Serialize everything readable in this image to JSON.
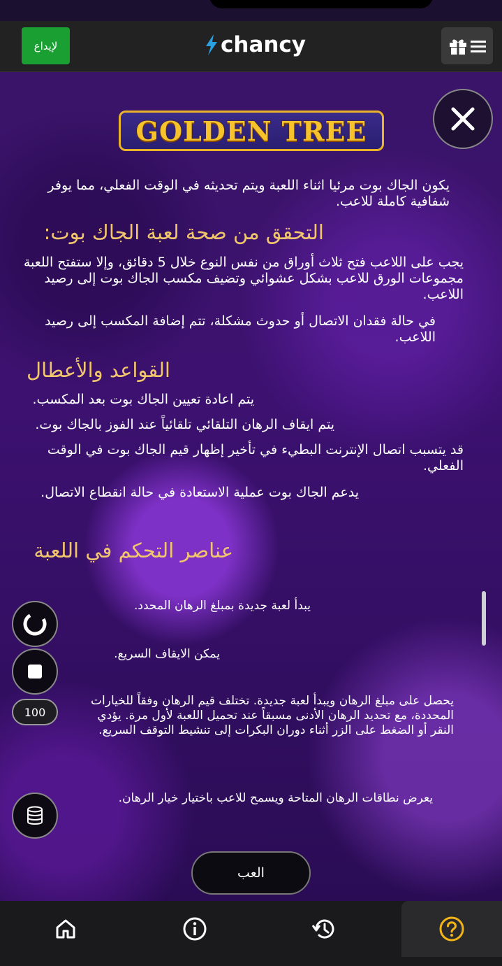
{
  "header": {
    "deposit_label": "لإيداع",
    "logo_text": "chancy"
  },
  "game": {
    "title": "GOLDEN TREE"
  },
  "rules": {
    "intro": "يكون الجاك بوت مرئيا اثناء اللعبة ويتم تحديثه في الوقت الفعلي، مما يوفر شفافية كاملة للاعب.",
    "verify_heading": "التحقق من صحة لعبة الجاك بوت:",
    "verify_p1": "يجب على اللاعب فتح ثلاث أوراق من نفس النوع خلال 5 دقائق، وإلا ستفتح اللعبة مجموعات الورق للاعب بشكل عشوائي وتضيف مكسب الجاك بوت إلى رصيد اللاعب.",
    "verify_p2": "في حالة فقدان الاتصال أو حدوث مشكلة، تتم إضافة المكسب إلى رصيد اللاعب.",
    "rules_heading": "القواعد والأعطال",
    "rule1": "يتم اعادة تعيين الجاك بوت بعد المكسب.",
    "rule2": "يتم ايقاف الرهان التلقائي تلقائياً عند الفوز بالجاك بوت.",
    "rule3": "قد يتسبب اتصال الإنترنت البطيء في تأخير إظهار قيم الجاك بوت في الوقت الفعلي.",
    "rule4": "يدعم الجاك بوت عملية الاستعادة في حالة انقطاع الاتصال."
  },
  "controls": {
    "heading": "عناصر التحكم في اللعبة",
    "spin_desc": "يبدأ لعبة جديدة بمبلغ الرهان المحدد.",
    "stop_desc": "يمكن الايقاف السريع.",
    "bet_value": "100",
    "bet_desc": "يحصل على مبلغ الرهان ويبدأ لعبة جديدة. تختلف قيم الرهان وفقاً للخيارات المحددة، مع تحديد الرهان الأدنى مسبقاً عند تحميل اللعبة لأول مرة. يؤدي النقر أو الضغط على الزر أثناء دوران البكرات إلى تنشيط التوقف السريع.",
    "stack_desc": "يعرض نطاقات الرهان المتاحة ويسمح للاعب باختيار خيار الرهان."
  },
  "play_label": "العب",
  "nav": {
    "items": [
      "home-icon",
      "info-icon",
      "history-icon",
      "help-icon"
    ],
    "active": "help-icon",
    "accent": "#f2b417"
  },
  "colors": {
    "deposit": "#1aa032",
    "heading": "#f2c66d",
    "title_gold": "#f6c32c"
  }
}
